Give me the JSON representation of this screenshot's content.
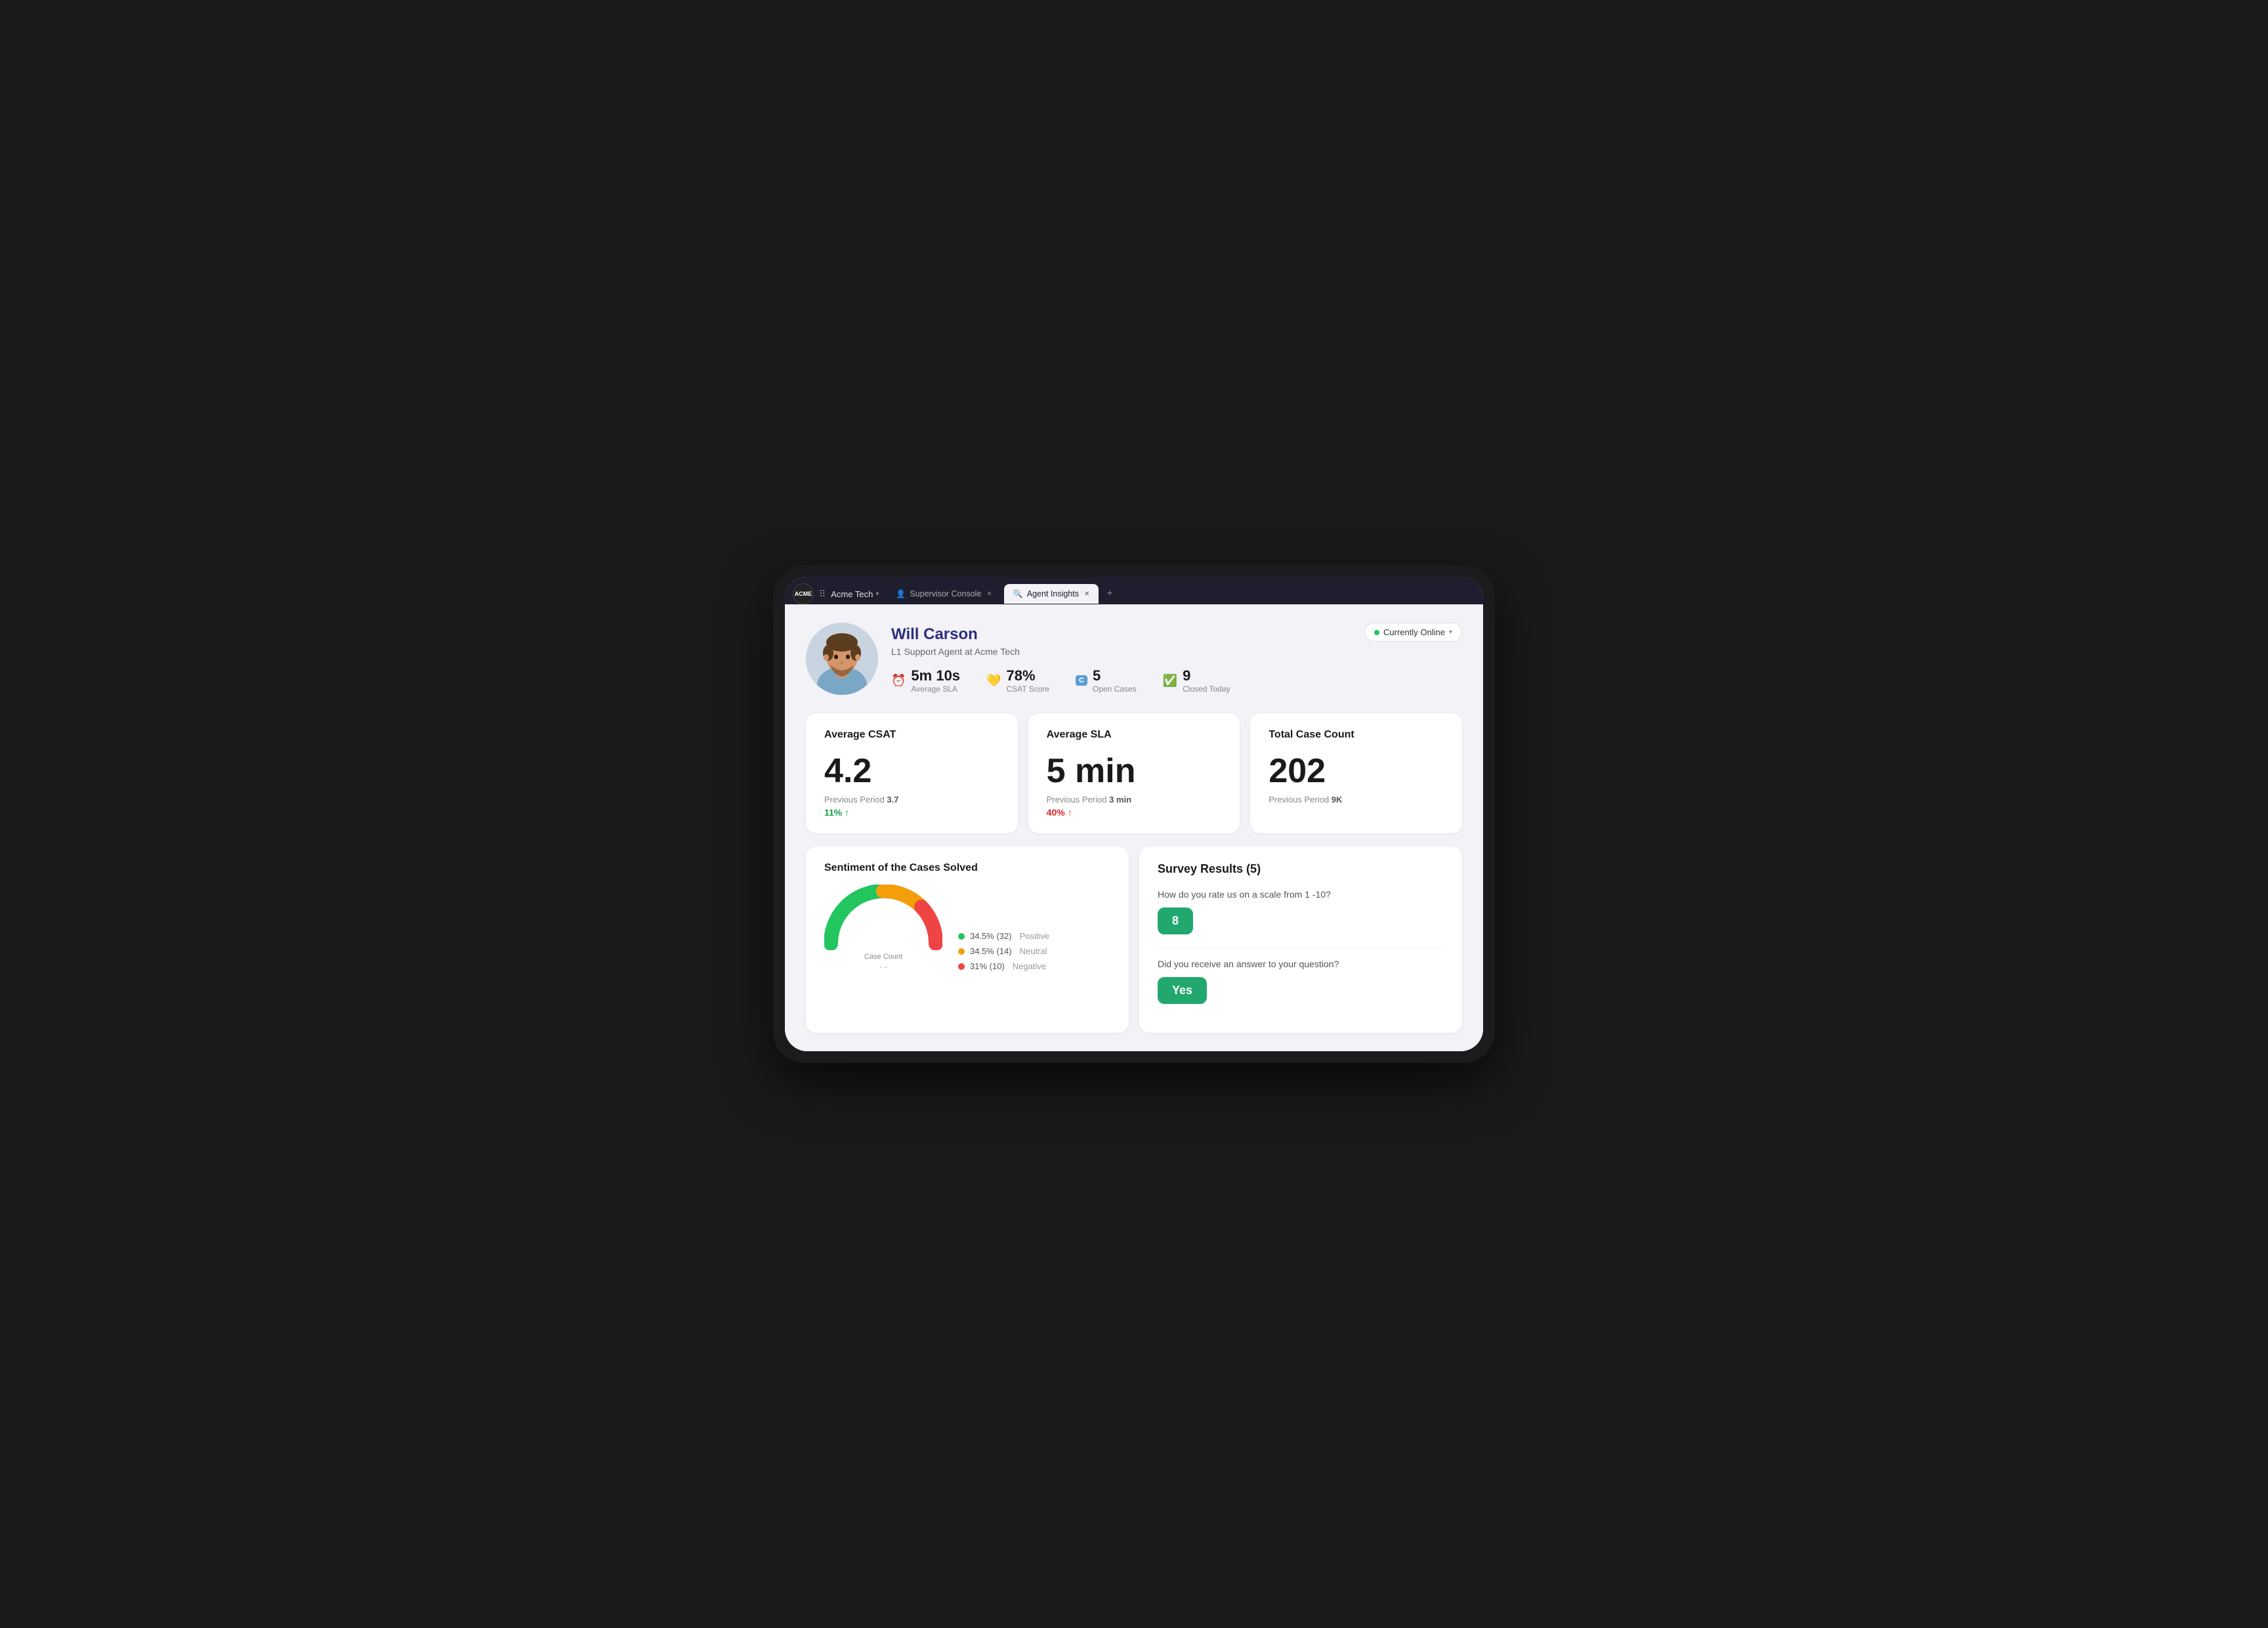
{
  "browser": {
    "workspace": "Acme Tech",
    "workspace_chevron": "▾",
    "grid_icon": "⠿",
    "tabs": [
      {
        "id": "supervisor",
        "label": "Supervisor Console",
        "icon": "👤",
        "active": false
      },
      {
        "id": "agent",
        "label": "Agent Insights",
        "icon": "🔍",
        "active": true
      }
    ],
    "new_tab_label": "+"
  },
  "agent": {
    "name": "Will Carson",
    "title": "L1 Support Agent at Acme Tech",
    "stats": [
      {
        "id": "sla",
        "icon": "⏰",
        "value": "5m 10s",
        "label": "Average SLA"
      },
      {
        "id": "csat",
        "icon": "💛",
        "value": "78%",
        "label": "CSAT Score"
      },
      {
        "id": "open",
        "icon": "C",
        "value": "5",
        "label": "Open Cases"
      },
      {
        "id": "closed",
        "icon": "✅",
        "value": "9",
        "label": "Closed Today"
      }
    ],
    "online_status": "Currently Online"
  },
  "metrics": [
    {
      "id": "avg-csat",
      "title": "Average CSAT",
      "value": "4.2",
      "previous_label": "Previous Period",
      "previous_value": "3.7",
      "change": "11%",
      "change_direction": "positive",
      "change_arrow": "↑"
    },
    {
      "id": "avg-sla",
      "title": "Average SLA",
      "value": "5 min",
      "previous_label": "Previous Period",
      "previous_value": "3 min",
      "change": "40%",
      "change_direction": "negative",
      "change_arrow": "↑"
    },
    {
      "id": "total-cases",
      "title": "Total Case Count",
      "value": "202",
      "previous_label": "Previous Period",
      "previous_value": "9K",
      "change": "",
      "change_direction": ""
    }
  ],
  "sentiment": {
    "title": "Sentiment of the Cases Solved",
    "gauge_label": "Case Count",
    "legend": [
      {
        "color": "#22c55e",
        "label": "34.5% (32)",
        "type": "Positive"
      },
      {
        "color": "#f59e0b",
        "label": "34.5% (14)",
        "type": "Neutral"
      },
      {
        "color": "#ef4444",
        "label": "31% (10)",
        "type": "Negative"
      }
    ]
  },
  "survey": {
    "title": "Survey Results (5)",
    "questions": [
      {
        "id": "q1",
        "question": "How do you rate us on a scale from 1 -10?",
        "answer": "8"
      },
      {
        "id": "q2",
        "question": "Did you receive an answer to your question?",
        "answer": "Yes"
      }
    ]
  },
  "colors": {
    "accent_blue": "#2d2d7e",
    "online_green": "#22c55e",
    "survey_green": "#22a86e",
    "positive_green": "#16a34a",
    "negative_red": "#dc2626",
    "gauge_green": "#22c55e",
    "gauge_yellow": "#f59e0b",
    "gauge_red": "#ef4444"
  }
}
